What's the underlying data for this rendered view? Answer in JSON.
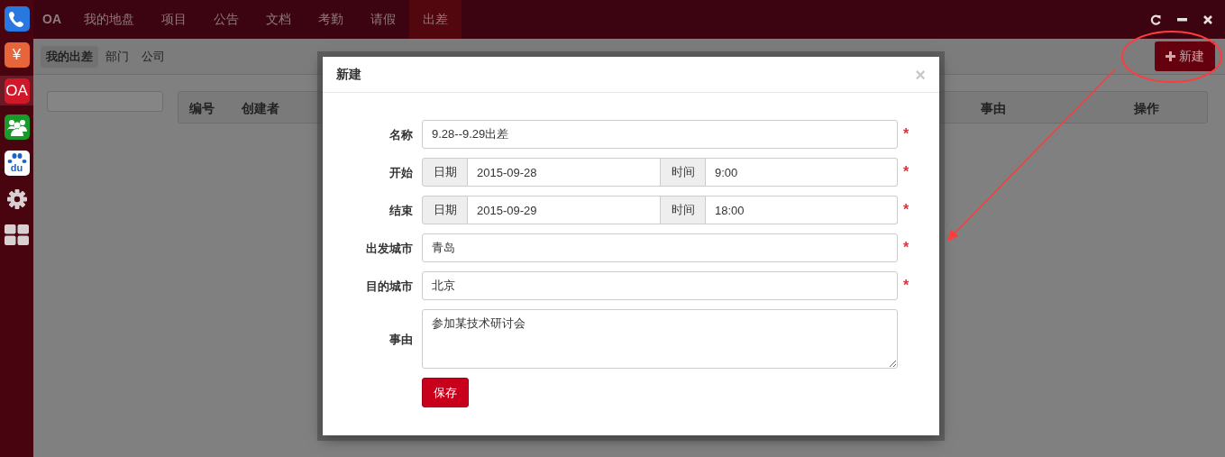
{
  "sidebar": {
    "apps": [
      {
        "kind": "phone",
        "selected": false
      },
      {
        "kind": "glyph",
        "label": "¥",
        "color": "#e8643a",
        "selected": false
      },
      {
        "kind": "glyph",
        "label": "OA",
        "color": "#d0182a",
        "selected": true
      },
      {
        "kind": "people",
        "selected": false
      },
      {
        "kind": "paw",
        "label": "du",
        "selected": false
      },
      {
        "kind": "gear",
        "selected": false
      },
      {
        "kind": "grid",
        "selected": false
      }
    ]
  },
  "nav": {
    "brand": "OA",
    "tabs": [
      {
        "label": "我的地盘",
        "selected": false
      },
      {
        "label": "项目",
        "selected": false
      },
      {
        "label": "公告",
        "selected": false
      },
      {
        "label": "文档",
        "selected": false
      },
      {
        "label": "考勤",
        "selected": false
      },
      {
        "label": "请假",
        "selected": false
      },
      {
        "label": "出差",
        "selected": true
      }
    ]
  },
  "subnav": {
    "tabs": [
      {
        "label": "我的出差",
        "selected": true
      },
      {
        "label": "部门",
        "selected": false
      },
      {
        "label": "公司",
        "selected": false
      }
    ],
    "new_button": "新建"
  },
  "table": {
    "columns": [
      "编号",
      "创建者",
      "事由",
      "操作"
    ]
  },
  "modal": {
    "title": "新建",
    "close": "×",
    "fields": [
      {
        "kind": "text",
        "label": "名称",
        "value": "9.28--9.29出差",
        "required": "*"
      },
      {
        "kind": "datetime",
        "label": "开始",
        "date_label": "日期",
        "date": "2015-09-28",
        "time_label": "时间",
        "time": "9:00",
        "required": "*"
      },
      {
        "kind": "datetime",
        "label": "结束",
        "date_label": "日期",
        "date": "2015-09-29",
        "time_label": "时间",
        "time": "18:00",
        "required": "*"
      },
      {
        "kind": "text",
        "label": "出发城市",
        "value": "青岛",
        "required": "*"
      },
      {
        "kind": "text",
        "label": "目的城市",
        "value": "北京",
        "required": "*"
      },
      {
        "kind": "textarea",
        "label": "事由",
        "value": "参加某技术研讨会"
      }
    ],
    "save": "保存"
  }
}
